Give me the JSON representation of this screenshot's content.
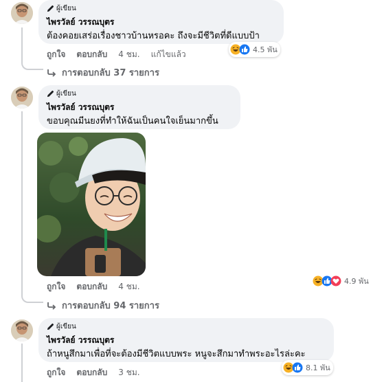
{
  "comments": [
    {
      "role_label": "ผู้เขียน",
      "author": "ไพรวัลย์ วรรณบุตร",
      "text": "ต้องคอยเสร่อเรื่องชาวบ้านหรอคะ ถึงจะมีชีวิตที่ดีแบบป้า",
      "actions": {
        "like": "ถูกใจ",
        "reply": "ตอบกลับ",
        "time": "4 ชม.",
        "edited": "แก้ไขแล้ว"
      },
      "reactions": {
        "icons": [
          "haha-icon",
          "like-icon"
        ],
        "count": "4.5 พัน"
      },
      "replies_label": "การตอบกลับ 37 รายการ"
    },
    {
      "role_label": "ผู้เขียน",
      "author": "ไพรวัลย์ วรรณบุตร",
      "text": "ขอบคุณมีนยงที่ทำให้ฉันเป็นคนใจเย็นมากขึ้น",
      "actions": {
        "like": "ถูกใจ",
        "reply": "ตอบกลับ",
        "time": "4 ชม."
      },
      "reactions": {
        "icons": [
          "haha-icon",
          "like-icon",
          "love-icon"
        ],
        "count": "4.9 พัน"
      },
      "replies_label": "การตอบกลับ 94 รายการ"
    },
    {
      "role_label": "ผู้เขียน",
      "author": "ไพรวัลย์ วรรณบุตร",
      "text": "ถ้าหนูสึกมาเพื่อที่จะต้องมีชีวิตแบบพระ หนูจะสึกมาทำพระอะไรล่ะคะ",
      "actions": {
        "like": "ถูกใจ",
        "reply": "ตอบกลับ",
        "time": "3 ชม."
      },
      "reactions": {
        "icons": [
          "haha-icon",
          "like-icon"
        ],
        "count": "8.1 พัน"
      }
    }
  ],
  "colors": {
    "bubble": "#f0f2f5",
    "meta": "#65676b",
    "like_blue": "#1877f2",
    "love_red": "#f33e58",
    "haha_yellow": "#f7b125"
  }
}
